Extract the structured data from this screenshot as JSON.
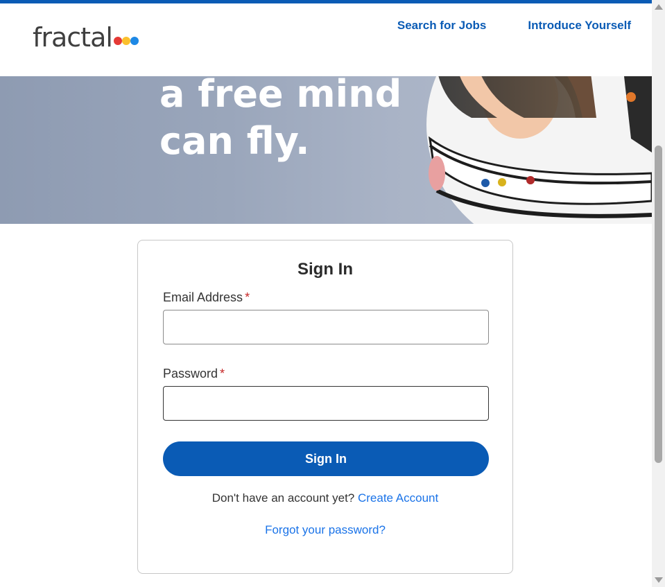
{
  "header": {
    "logo_text": "fractal",
    "logo_dot_colors": [
      "#e53935",
      "#fbc02d",
      "#1e88e5"
    ],
    "nav": [
      {
        "label": "Search for Jobs"
      },
      {
        "label": "Introduce Yourself"
      }
    ]
  },
  "hero": {
    "line1": "a free mind",
    "line2": "can fly."
  },
  "signin": {
    "title": "Sign In",
    "email_label": "Email Address",
    "required_mark": "*",
    "email_value": "",
    "password_label": "Password",
    "password_value": "",
    "button_label": "Sign In",
    "no_account_text": "Don't have an account yet?",
    "create_account_label": "Create Account",
    "forgot_label": "Forgot your password?"
  },
  "colors": {
    "brand_blue": "#0a5bb5",
    "link_blue": "#1a73e8",
    "required_red": "#c62828"
  }
}
